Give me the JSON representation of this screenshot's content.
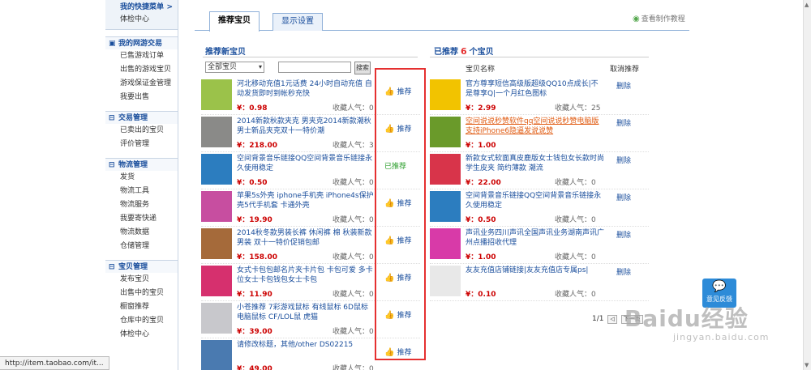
{
  "sidebar": {
    "quick": {
      "title": "我的快捷菜单",
      "arrow": ">",
      "items": [
        "体检中心"
      ]
    },
    "groups": [
      {
        "title": "我的网游交易",
        "toggle": "▣",
        "items": [
          "已售游戏订单",
          "出售的游戏宝贝",
          "游戏保证金管理",
          "我要出售"
        ]
      },
      {
        "title": "交易管理",
        "toggle": "⊟",
        "items": [
          "已卖出的宝贝",
          "评价管理"
        ]
      },
      {
        "title": "物流管理",
        "toggle": "⊟",
        "items": [
          "发货",
          "物流工具",
          "物流服务",
          "我要寄快递",
          "物流数据",
          "仓储管理"
        ]
      },
      {
        "title": "宝贝管理",
        "toggle": "⊟",
        "items": [
          "发布宝贝",
          "出售中的宝贝",
          "橱窗推荐",
          "仓库中的宝贝",
          "体检中心"
        ]
      }
    ]
  },
  "tabs": {
    "active": "推荐宝贝",
    "inactive": "显示设置"
  },
  "help": {
    "icon": "◉",
    "label": "查看制作教程"
  },
  "left": {
    "title": "推荐新宝贝",
    "filter_value": "全部宝贝",
    "search_placeholder": "",
    "search_button": "搜索",
    "products": [
      {
        "title": "河北移动充值1元话费 24小时自动充值 自动发货即时到帐秒充快",
        "price": "¥：0.98",
        "popularity": "收藏人气：0",
        "action": "推荐",
        "thumb_color": "#9bc24a"
      },
      {
        "title": "2014新款秋款夹克 男夹克2014新款潮秋 男士新品夹克双十一特价潮",
        "price": "¥：218.00",
        "popularity": "收藏人气：3",
        "action": "推荐",
        "thumb_color": "#8a8a88"
      },
      {
        "title": "空间背景音乐链接QQ空间背景音乐链接永久使用稳定",
        "price": "¥：0.50",
        "popularity": "收藏人气：0",
        "action": "已推荐",
        "thumb_color": "#2c7dbf"
      },
      {
        "title": "苹果5s外壳 iphone手机壳 iPhone4s保护壳5代手机套 卡通外壳",
        "price": "¥：19.90",
        "popularity": "收藏人气：0",
        "action": "推荐",
        "thumb_color": "#c74ea0"
      },
      {
        "title": "2014秋冬款男装长裤 休闲裤 棉 秋装新款男装 双十一特价促销包邮",
        "price": "¥：158.00",
        "popularity": "收藏人气：0",
        "action": "推荐",
        "thumb_color": "#a56a3a"
      },
      {
        "title": "女式卡包包邮名片夹卡片包 卡包可爱 多卡位女士卡包钱包女士卡包",
        "price": "¥：11.90",
        "popularity": "收藏人气：0",
        "action": "推荐",
        "thumb_color": "#d6306e"
      },
      {
        "title": "小苍推荐 7彩游戏鼠标 有线鼠标 6D鼠标 电脑鼠标 CF/LOL鼠 虎猫",
        "price": "¥：39.00",
        "popularity": "收藏人气：0",
        "action": "推荐",
        "thumb_color": "#c8c8cc"
      },
      {
        "title": "请修改标题，其他/other DS02215",
        "price": "¥：49.00",
        "popularity": "收藏人气：0",
        "action": "推荐",
        "thumb_color": "#4a7ab0"
      }
    ]
  },
  "right": {
    "title_prefix": "已推荐",
    "count": "6",
    "title_suffix": "个宝贝",
    "col_name": "宝贝名称",
    "col_cancel": "取消推荐",
    "items": [
      {
        "title": "官方尊享短信高级版超级QQ10点成长|不是尊享Q|一个月红色图标",
        "price": "¥：2.99",
        "popularity": "收藏人气：25",
        "action": "删除",
        "thumb_color": "#f2c300",
        "highlight": false
      },
      {
        "title": "空间说说秒赞软件qq空间说说秒赞电脑版支持iPhone6隐逼发说说赞",
        "price": "¥：1.00",
        "popularity": "",
        "action": "删除",
        "thumb_color": "#6a9a2a",
        "highlight": true
      },
      {
        "title": "新款女式软面真皮鹿版女士钱包女长款时尚学生皮夹 简约薄款 潮流",
        "price": "¥：22.00",
        "popularity": "收藏人气：0",
        "action": "删除",
        "thumb_color": "#d8344a",
        "highlight": false
      },
      {
        "title": "空间背景音乐链接QQ空间背景音乐链接永久使用稳定",
        "price": "¥：0.50",
        "popularity": "收藏人气：0",
        "action": "删除",
        "thumb_color": "#2c7dbf",
        "highlight": false
      },
      {
        "title": "声讯业务四川声讯全国声讯业务湖南声讯广州点播招收代理",
        "price": "¥：1.00",
        "popularity": "收藏人气：0",
        "action": "删除",
        "thumb_color": "#d83aa8",
        "highlight": false
      },
      {
        "title": "友友充值店铺链接|友友充值店专属ps|",
        "price": "¥：0.10",
        "popularity": "收藏人气：0",
        "action": "删除",
        "thumb_color": "#e8e8e8",
        "highlight": false
      }
    ],
    "pager": {
      "text": "1/1",
      "prev": "◁",
      "next": "下一页"
    }
  },
  "status_bar": "http://item.taobao.com/it...",
  "chat": {
    "icon": "💬",
    "label": "意见反馈"
  },
  "watermark": {
    "line1": "Baidu经验",
    "line2": "jingyan.baidu.com"
  },
  "scrollbar": {
    "up": "▲",
    "down": "▼"
  }
}
